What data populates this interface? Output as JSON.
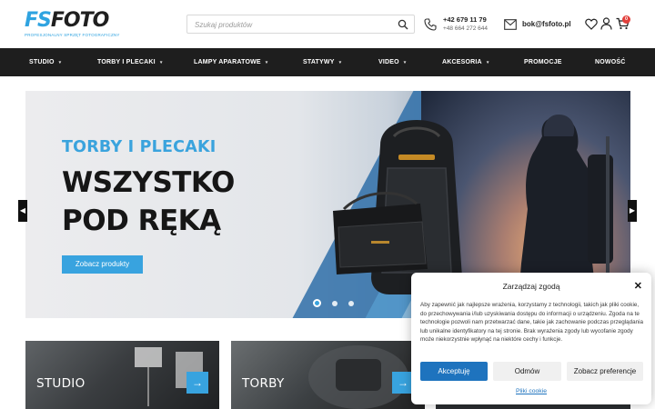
{
  "header": {
    "logo_text_fs": "FS",
    "logo_text_foto": "FOTO",
    "logo_tagline": "PROFESJONALNY SPRZĘT FOTOGRAFICZNY",
    "search_placeholder": "Szukaj produktów",
    "phone_primary": "+42 679 11 79",
    "phone_secondary": "+48 664 272 644",
    "email": "bok@fsfoto.pl",
    "cart_count": "0"
  },
  "nav": {
    "items": [
      {
        "label": "STUDIO",
        "caret": "▾"
      },
      {
        "label": "TORBY I PLECAKI",
        "caret": "▾"
      },
      {
        "label": "LAMPY APARATOWE",
        "caret": "▾"
      },
      {
        "label": "STATYWY",
        "caret": "▾"
      },
      {
        "label": "VIDEO",
        "caret": "▾"
      },
      {
        "label": "AKCESORIA",
        "caret": "▾"
      },
      {
        "label": "PROMOCJE",
        "caret": ""
      },
      {
        "label": "NOWOŚĆ",
        "caret": ""
      }
    ]
  },
  "hero": {
    "subtitle": "TORBY I PLECAKI",
    "title_line1": "WSZYSTKO",
    "title_line2": "POD RĘKĄ",
    "cta": "Zobacz produkty",
    "slides_total": 3,
    "active_slide": 1
  },
  "tiles": [
    {
      "label": "STUDIO",
      "arrow": "→"
    },
    {
      "label": "TORBY",
      "arrow": "→"
    },
    {
      "label": "",
      "arrow": ""
    }
  ],
  "consent": {
    "title": "Zarządzaj zgodą",
    "close": "✕",
    "text": "Aby zapewnić jak najlepsze wrażenia, korzystamy z technologii, takich jak pliki cookie, do przechowywania i/lub uzyskiwania dostępu do informacji o urządzeniu. Zgoda na te technologie pozwoli nam przetwarzać dane, takie jak zachowanie podczas przeglądania lub unikalne identyfikatory na tej stronie. Brak wyrażenia zgody lub wycofanie zgody może niekorzystnie wpłynąć na niektóre cechy i funkcje.",
    "accept": "Akceptuję",
    "deny": "Odmów",
    "preferences": "Zobacz preferencje",
    "cookie_link": "Pliki cookie"
  },
  "colors": {
    "accent": "#38a3df",
    "nav_bg": "#1e1e1e",
    "consent_primary": "#1e73be",
    "badge": "#e2403c"
  }
}
